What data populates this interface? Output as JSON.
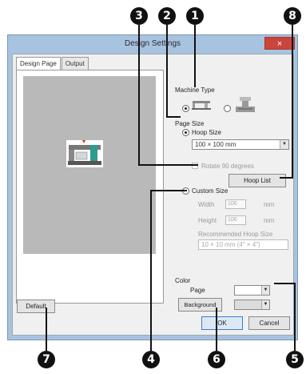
{
  "callouts": [
    "3",
    "2",
    "1",
    "8",
    "4",
    "6",
    "5",
    "7"
  ],
  "dialog": {
    "title": "Design Settings",
    "close_label": "×",
    "tabs": [
      {
        "label": "Design Page"
      },
      {
        "label": "Output"
      }
    ],
    "machine_type": {
      "label": "Machine Type"
    },
    "page_size": {
      "label": "Page Size",
      "hoop_option": "Hoop Size",
      "hoop_value": "100 × 100 mm",
      "hoop_icon": "chevron-down-icon",
      "rotate_label": "Rotate 90 degrees",
      "hoop_list_button": "Hoop List"
    },
    "custom_size": {
      "label": "Custom Size",
      "width_label": "Width",
      "width_value": "100",
      "height_label": "Height",
      "height_value": "100",
      "unit": "mm",
      "recommended_label": "Recommended Hoop Size",
      "recommended_value": "10 × 10 mm (4\" × 4\")"
    },
    "color": {
      "label": "Color",
      "page_label": "Page",
      "background_button": "Background"
    },
    "buttons": {
      "default": "Default",
      "ok": "OK",
      "cancel": "Cancel"
    }
  }
}
